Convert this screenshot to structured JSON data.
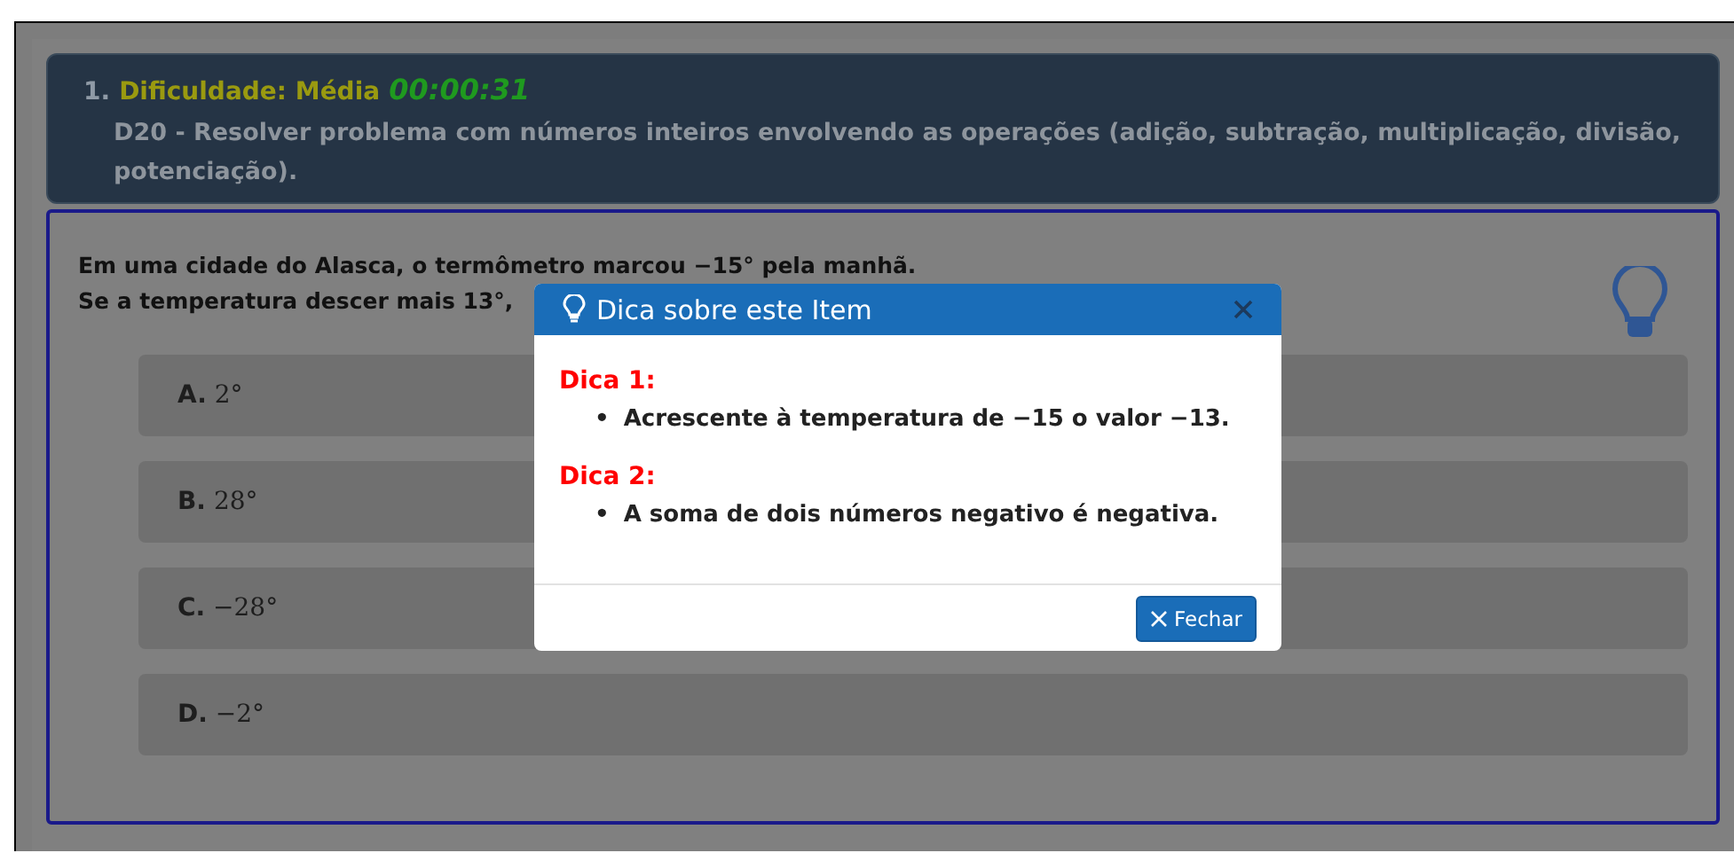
{
  "header": {
    "number": "1.",
    "difficulty": "Dificuldade: Média",
    "timer": "00:00:31",
    "descriptor": "D20 - Resolver problema com números inteiros envolvendo as operações (adição, subtração, multiplicação, divisão, potenciação)."
  },
  "question": {
    "statement": [
      "Em uma cidade do Alasca, o termômetro marcou −15° pela manhã.",
      "Se a temperatura descer mais 13°,"
    ],
    "options": [
      {
        "letter": "A.",
        "text": "2°"
      },
      {
        "letter": "B.",
        "text": "28°"
      },
      {
        "letter": "C.",
        "text": "−28°"
      },
      {
        "letter": "D.",
        "text": "−2°"
      }
    ]
  },
  "hint_modal": {
    "title": "Dica sobre este Item",
    "bullet": "•",
    "hints": [
      {
        "label": "Dica 1:",
        "items": [
          "Acrescente à temperatura de −15 o valor −13."
        ]
      },
      {
        "label": "Dica 2:",
        "items": [
          "A soma de dois números negativo é negativa."
        ]
      }
    ],
    "close_button": "Fechar"
  }
}
